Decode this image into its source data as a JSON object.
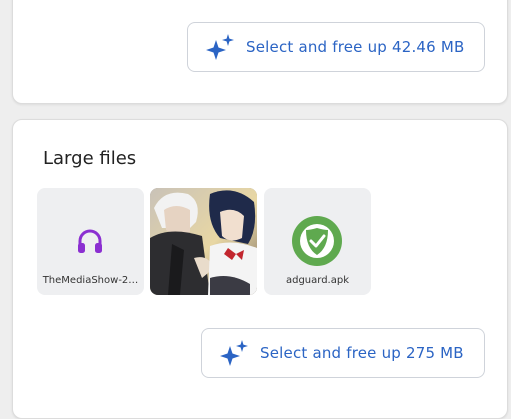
{
  "top_card": {
    "button_label": "Select and free up 42.46 MB",
    "button_icon": "sparkle-icon"
  },
  "large_files": {
    "title": "Large files",
    "items": [
      {
        "name": "TheMediaShow-2…",
        "icon": "headphones-icon",
        "icon_color": "#8b2fd1"
      },
      {
        "name": "",
        "icon": "anime-image-thumbnail"
      },
      {
        "name": "adguard.apk",
        "icon": "adguard-shield-icon",
        "icon_color": "#5fa94f"
      }
    ],
    "button_label": "Select and free up 275 MB",
    "button_icon": "sparkle-icon"
  },
  "colors": {
    "accent": "#2b64c4",
    "card": "#ffffff",
    "background": "#eeeeee"
  }
}
